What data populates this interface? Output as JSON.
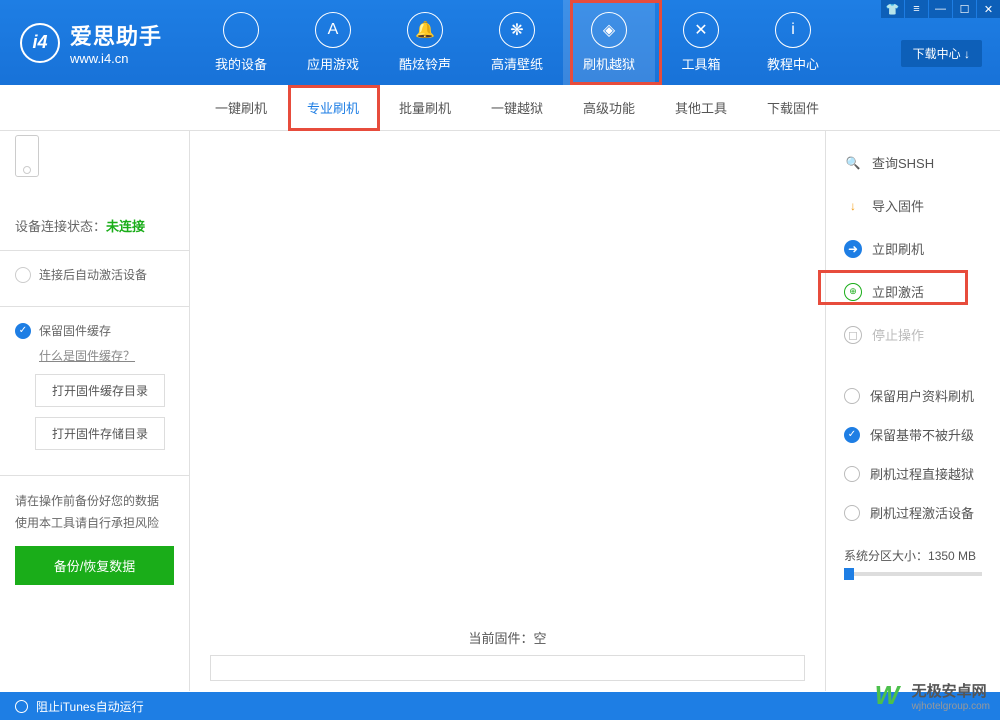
{
  "header": {
    "logo_title": "爱思助手",
    "logo_url": "www.i4.cn",
    "nav": [
      {
        "label": "我的设备",
        "icon": ""
      },
      {
        "label": "应用游戏",
        "icon": "A"
      },
      {
        "label": "酷炫铃声",
        "icon": "🔔"
      },
      {
        "label": "高清壁纸",
        "icon": "❋"
      },
      {
        "label": "刷机越狱",
        "icon": "◈"
      },
      {
        "label": "工具箱",
        "icon": "✕"
      },
      {
        "label": "教程中心",
        "icon": "i"
      }
    ],
    "download_center": "下载中心 ↓",
    "win_ctrls": [
      "👕",
      "≡",
      "—",
      "☐",
      "✕"
    ]
  },
  "subnav": [
    "一键刷机",
    "专业刷机",
    "批量刷机",
    "一键越狱",
    "高级功能",
    "其他工具",
    "下载固件"
  ],
  "sidebar": {
    "status_label": "设备连接状态：",
    "status_value": "未连接",
    "auto_activate": "连接后自动激活设备",
    "keep_cache": "保留固件缓存",
    "cache_help": "什么是固件缓存？",
    "btn_open_cache": "打开固件缓存目录",
    "btn_open_store": "打开固件存储目录",
    "warn_line1": "请在操作前备份好您的数据",
    "warn_line2": "使用本工具请自行承担风险",
    "backup_btn": "备份/恢复数据"
  },
  "main": {
    "firmware_label": "当前固件：",
    "firmware_value": "空"
  },
  "right_panel": {
    "items": [
      {
        "label": "查询SHSH",
        "iconClass": "orange",
        "icon": "🔍"
      },
      {
        "label": "导入固件",
        "iconClass": "orange",
        "icon": "↓"
      },
      {
        "label": "立即刷机",
        "iconClass": "blue",
        "icon": "➜"
      },
      {
        "label": "立即激活",
        "iconClass": "green",
        "icon": "⊕"
      },
      {
        "label": "停止操作",
        "iconClass": "grey",
        "icon": "◻",
        "disabled": true
      }
    ],
    "options": [
      {
        "label": "保留用户资料刷机",
        "checked": false
      },
      {
        "label": "保留基带不被升级",
        "checked": true
      },
      {
        "label": "刷机过程直接越狱",
        "checked": false
      },
      {
        "label": "刷机过程激活设备",
        "checked": false
      }
    ],
    "partition_label": "系统分区大小：",
    "partition_value": "1350 MB"
  },
  "footer": {
    "itunes_block": "阻止iTunes自动运行"
  },
  "watermark": {
    "name": "无极安卓网",
    "url": "wjhotelgroup.com"
  }
}
